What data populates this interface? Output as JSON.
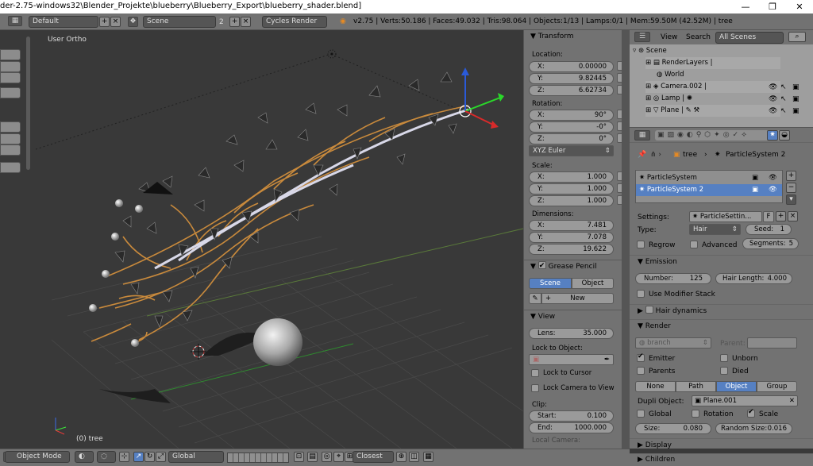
{
  "window": {
    "title": "der-2.75-windows32\\Blender_Projekte\\blueberry\\Blueberry_Export\\blueberry_shader.blend]",
    "min": "—",
    "max": "❐",
    "close": "✕"
  },
  "info": {
    "screen": "Default",
    "scene": "Scene",
    "scene_users": "2",
    "engine": "Cycles Render",
    "stats": "v2.75 | Verts:50.186 | Faces:49.032 | Tris:98.064 | Objects:1/13 | Lamps:0/1 | Mem:59.50M (42.52M) | tree"
  },
  "viewport": {
    "view_label": "User Ortho",
    "object_label": "(0) tree"
  },
  "npanel": {
    "transform_title": "Transform",
    "location_label": "Location:",
    "location": [
      {
        "axis": "X:",
        "value": "0.00000"
      },
      {
        "axis": "Y:",
        "value": "9.82445"
      },
      {
        "axis": "Z:",
        "value": "6.62734"
      }
    ],
    "rotation_label": "Rotation:",
    "rotation": [
      {
        "axis": "X:",
        "value": "90°"
      },
      {
        "axis": "Y:",
        "value": "-0°"
      },
      {
        "axis": "Z:",
        "value": "0°"
      }
    ],
    "rotation_mode": "XYZ Euler",
    "scale_label": "Scale:",
    "scale": [
      {
        "axis": "X:",
        "value": "1.000"
      },
      {
        "axis": "Y:",
        "value": "1.000"
      },
      {
        "axis": "Z:",
        "value": "1.000"
      }
    ],
    "dimensions_label": "Dimensions:",
    "dimensions": [
      {
        "axis": "X:",
        "value": "7.481"
      },
      {
        "axis": "Y:",
        "value": "7.078"
      },
      {
        "axis": "Z:",
        "value": "19.622"
      }
    ],
    "grease_title": "Grease Pencil",
    "grease_scene": "Scene",
    "grease_object": "Object",
    "grease_new": "New",
    "view_title": "View",
    "lens_label": "Lens:",
    "lens_value": "35.000",
    "lock_object_label": "Lock to Object:",
    "lock_cursor": "Lock to Cursor",
    "lock_camera": "Lock Camera to View",
    "clip_label": "Clip:",
    "clip_start_label": "Start:",
    "clip_start": "0.100",
    "clip_end_label": "End:",
    "clip_end": "1000.000",
    "local_camera": "Local Camera:"
  },
  "outliner": {
    "view": "View",
    "search": "Search",
    "filter": "All Scenes",
    "items": [
      {
        "label": "Scene"
      },
      {
        "label": "RenderLayers"
      },
      {
        "label": "World"
      },
      {
        "label": "Camera.002"
      },
      {
        "label": "Lamp"
      },
      {
        "label": "Plane"
      }
    ]
  },
  "props": {
    "breadcrumb_obj": "tree",
    "breadcrumb_ps": "ParticleSystem 2",
    "systems": [
      "ParticleSystem",
      "ParticleSystem 2"
    ],
    "settings_label": "Settings:",
    "settings_value": "ParticleSettin...",
    "settings_f": "F",
    "type_label": "Type:",
    "type_value": "Hair",
    "seed_label": "Seed:",
    "seed_value": "1",
    "regrow": "Regrow",
    "advanced": "Advanced",
    "segments_label": "Segments:",
    "segments_value": "5",
    "emission_title": "Emission",
    "number_label": "Number:",
    "number_value": "125",
    "hairlen_label": "Hair Length:",
    "hairlen_value": "4.000",
    "use_modifier_stack": "Use Modifier Stack",
    "hair_dynamics": "Hair dynamics",
    "render_title": "Render",
    "material": "branch",
    "parent_label": "Parent:",
    "emitter": "Emitter",
    "unborn": "Unborn",
    "parents": "Parents",
    "died": "Died",
    "render_as": [
      "None",
      "Path",
      "Object",
      "Group"
    ],
    "dupli_label": "Dupli Object:",
    "dupli_value": "Plane.001",
    "global": "Global",
    "rotation": "Rotation",
    "scale": "Scale",
    "size_label": "Size:",
    "size_value": "0.080",
    "random_label": "Random Size:",
    "random_value": "0.016",
    "display": "Display",
    "children": "Children"
  },
  "bottom": {
    "mode": "Object Mode",
    "orientation": "Global",
    "snap": "Closest"
  },
  "colors": {
    "active": "#5680c2",
    "bg": "#393939",
    "panel": "#727272"
  }
}
